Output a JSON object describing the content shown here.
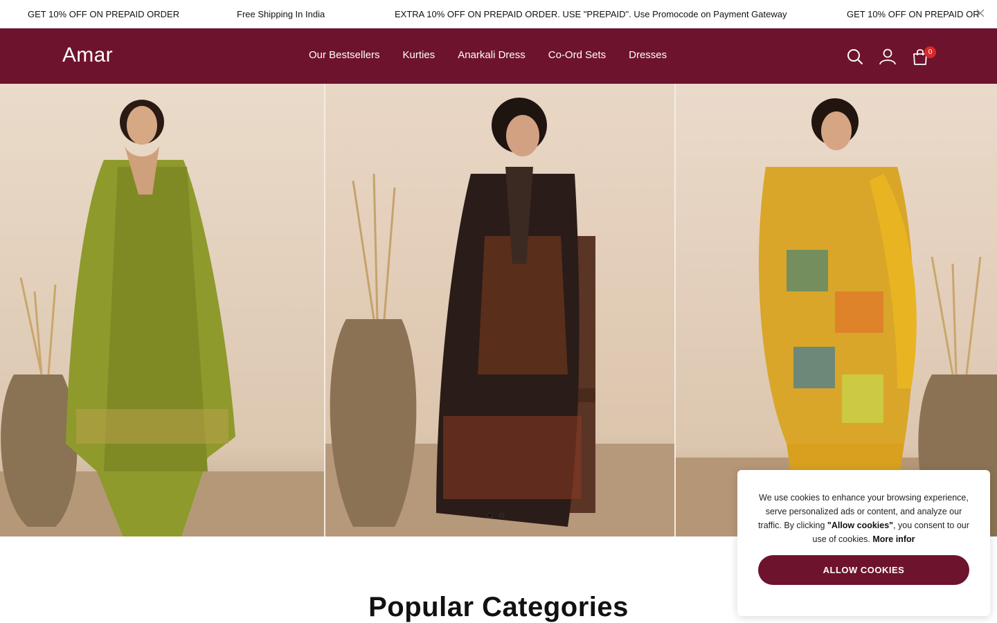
{
  "announcement": {
    "messages": [
      "GET 10% OFF ON PREPAID ORDER",
      "Free Shipping In India",
      "EXTRA 10% OFF ON PREPAID ORDER. USE \"PREPAID\". Use Promocode on Payment Gateway",
      "GET 10% OFF ON PREPAID OR"
    ],
    "close_icon": "close-icon"
  },
  "header": {
    "logo": "Amar",
    "nav": [
      "Our Bestsellers",
      "Kurties",
      "Anarkali Dress",
      "Co-Ord Sets",
      "Dresses"
    ],
    "icons": [
      "search-icon",
      "user-icon",
      "cart-icon"
    ],
    "cart_count": "0",
    "brand_color": "#6e132d"
  },
  "hero": {
    "slides_count": 2,
    "active_slide": 1,
    "panel_colors": [
      "#9a9a2c",
      "#2b1e18",
      "#d9a62a"
    ]
  },
  "section": {
    "title": "Popular Categories"
  },
  "cookie": {
    "text_1": "We use cookies to enhance your browsing experience, serve personalized ads or content, and analyze our traffic. By clicking ",
    "text_bold": "\"Allow cookies\"",
    "text_2": ", you consent to our use of cookies. ",
    "more_link": "More infor",
    "button": "ALLOW COOKIES"
  }
}
